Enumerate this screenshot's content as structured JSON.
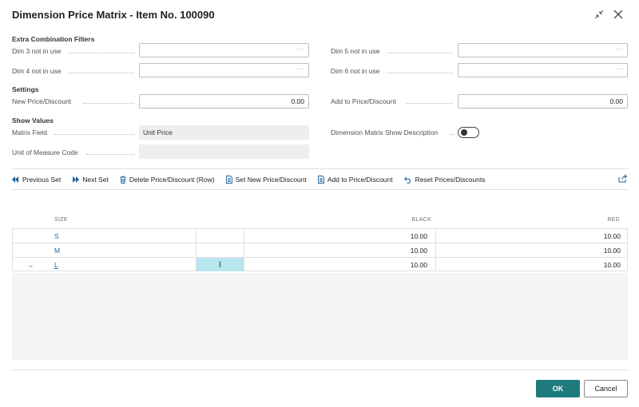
{
  "window": {
    "title": "Dimension Price Matrix - Item No. 100090"
  },
  "sections": {
    "extra_filters": "Extra Combination Filters",
    "settings": "Settings",
    "show_values": "Show Values"
  },
  "fields": {
    "dim3": {
      "label": "Dim 3 not in use",
      "value": ""
    },
    "dim4": {
      "label": "Dim 4 not in use",
      "value": ""
    },
    "dim5": {
      "label": "Dim 5 not in use",
      "value": ""
    },
    "dim6": {
      "label": "Dim 6 not in use",
      "value": ""
    },
    "new_price": {
      "label": "New Price/Discount",
      "value": "0.00"
    },
    "add_price": {
      "label": "Add to Price/Discount",
      "value": "0.00"
    },
    "matrix_field": {
      "label": "Matrix Field",
      "value": "Unit Price"
    },
    "uom_code": {
      "label": "Unit of Measure Code",
      "value": ""
    },
    "show_description": {
      "label": "Dimension Matrix Show Description",
      "on": false
    }
  },
  "ellipsis": "···",
  "actions": [
    {
      "label": "Previous Set",
      "icon": "previous-set-icon"
    },
    {
      "label": "Next Set",
      "icon": "next-set-icon"
    },
    {
      "label": "Delete Price/Discount (Row)",
      "icon": "trash-icon"
    },
    {
      "label": "Set New Price/Discount",
      "icon": "document-icon"
    },
    {
      "label": "Add to Price/Discount",
      "icon": "document-icon"
    },
    {
      "label": "Reset Prices/Discounts",
      "icon": "undo-icon"
    }
  ],
  "grid": {
    "columns": {
      "size": "SIZE",
      "black": "BLACK",
      "red": "RED"
    },
    "rows": [
      {
        "size": "S",
        "black": "10.00",
        "red": "10.00"
      },
      {
        "size": "M",
        "black": "10.00",
        "red": "10.00"
      },
      {
        "size": "L",
        "black": "10.00",
        "red": "10.00",
        "selected": true
      }
    ],
    "row_marker": "→",
    "kebab": "⋮"
  },
  "buttons": {
    "ok": "OK",
    "cancel": "Cancel"
  },
  "colors": {
    "accent": "#1f7a7d",
    "link": "#1a6aa8",
    "selected_cell": "#b8e6ee"
  }
}
